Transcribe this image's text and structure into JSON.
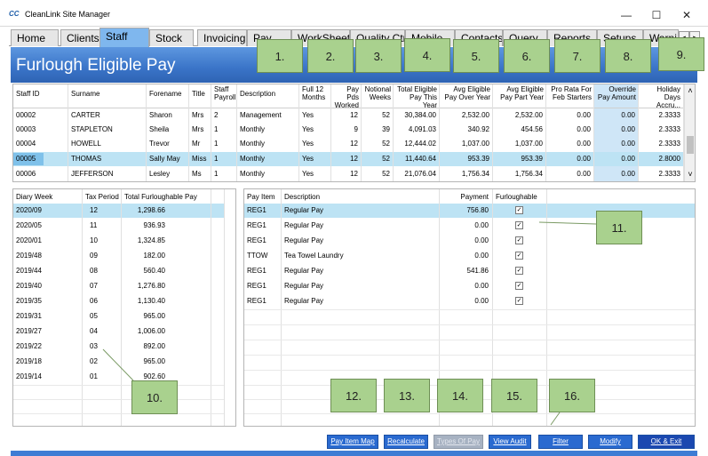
{
  "app": {
    "logo_text": "CC",
    "title": "CleanLink Site Manager"
  },
  "window": {
    "minimize": "—",
    "maximize": "☐",
    "close": "✕"
  },
  "tabs": [
    "Home",
    "Clients",
    "Staff",
    "Stock",
    "Invoicing",
    "Pay",
    "WorkSheet",
    "Quality Ctrl",
    "Mobile",
    "Contacts",
    "Query",
    "Reports",
    "Setups",
    "Warni"
  ],
  "active_tab": "Staff",
  "tab_scroll": {
    "left": "◂",
    "right": "▸"
  },
  "page_title": "Furlough Eligible Pay",
  "callouts": [
    "1.",
    "2.",
    "3.",
    "4.",
    "5.",
    "6.",
    "7.",
    "8.",
    "9.",
    "10.",
    "11.",
    "12.",
    "13.",
    "14.",
    "15.",
    "16."
  ],
  "staff_grid": {
    "headers": [
      "Staff ID",
      "Surname",
      "Forename",
      "Title",
      "Staff Payroll",
      "Description",
      "Full 12 Months",
      "Pay Pds Worked",
      "Notional Weeks",
      "Total Eligible Pay This Year",
      "Avg Eligible Pay Over Year",
      "Avg Eligible Pay Part Year",
      "Pro Rata For Feb Starters",
      "Override Pay Amount",
      "Holiday Days Accru..."
    ],
    "rows": [
      [
        "00002",
        "CARTER",
        "Sharon",
        "Mrs",
        "2",
        "Management",
        "Yes",
        "12",
        "52",
        "30,384.00",
        "2,532.00",
        "2,532.00",
        "0.00",
        "0.00",
        "2.3333"
      ],
      [
        "00003",
        "STAPLETON",
        "Sheila",
        "Mrs",
        "1",
        "Monthly",
        "Yes",
        "9",
        "39",
        "4,091.03",
        "340.92",
        "454.56",
        "0.00",
        "0.00",
        "2.3333"
      ],
      [
        "00004",
        "HOWELL",
        "Trevor",
        "Mr",
        "1",
        "Monthly",
        "Yes",
        "12",
        "52",
        "12,444.02",
        "1,037.00",
        "1,037.00",
        "0.00",
        "0.00",
        "2.3333"
      ],
      [
        "00005",
        "THOMAS",
        "Sally May",
        "Miss",
        "1",
        "Monthly",
        "Yes",
        "12",
        "52",
        "11,440.64",
        "953.39",
        "953.39",
        "0.00",
        "0.00",
        "2.8000"
      ],
      [
        "00006",
        "JEFFERSON",
        "Lesley",
        "Ms",
        "1",
        "Monthly",
        "Yes",
        "12",
        "52",
        "21,076.04",
        "1,756.34",
        "1,756.34",
        "0.00",
        "0.00",
        "2.3333"
      ]
    ],
    "scroll_up": "˄",
    "scroll_down": "˅"
  },
  "diary_grid": {
    "headers": [
      "Diary Week",
      "Tax Period",
      "Total Furloughable Pay"
    ],
    "rows": [
      [
        "2020/09",
        "12",
        "1,298.66"
      ],
      [
        "2020/05",
        "11",
        "936.93"
      ],
      [
        "2020/01",
        "10",
        "1,324.85"
      ],
      [
        "2019/48",
        "09",
        "182.00"
      ],
      [
        "2019/44",
        "08",
        "560.40"
      ],
      [
        "2019/40",
        "07",
        "1,276.80"
      ],
      [
        "2019/35",
        "06",
        "1,130.40"
      ],
      [
        "2019/31",
        "05",
        "965.00"
      ],
      [
        "2019/27",
        "04",
        "1,006.00"
      ],
      [
        "2019/22",
        "03",
        "892.00"
      ],
      [
        "2019/18",
        "02",
        "965.00"
      ],
      [
        "2019/14",
        "01",
        "902.60"
      ]
    ]
  },
  "payitem_grid": {
    "headers": [
      "Pay Item",
      "Description",
      "Payment",
      "Furloughable"
    ],
    "rows": [
      [
        "REG1",
        "Regular Pay",
        "756.80",
        "✓"
      ],
      [
        "REG1",
        "Regular Pay",
        "0.00",
        "✓"
      ],
      [
        "REG1",
        "Regular Pay",
        "0.00",
        "✓"
      ],
      [
        "TTOW",
        "Tea Towel Laundry",
        "0.00",
        "✓"
      ],
      [
        "REG1",
        "Regular Pay",
        "541.86",
        "✓"
      ],
      [
        "REG1",
        "Regular Pay",
        "0.00",
        "✓"
      ],
      [
        "REG1",
        "Regular Pay",
        "0.00",
        "✓"
      ]
    ]
  },
  "buttons": {
    "pay_item_map": "Pay Item Map",
    "recalculate": "Recalculate",
    "types_of_pay": "Types Of Pay",
    "view_audit": "View Audit",
    "filter": "Filter",
    "modify": "Modify",
    "ok_exit": "OK & Exit"
  }
}
